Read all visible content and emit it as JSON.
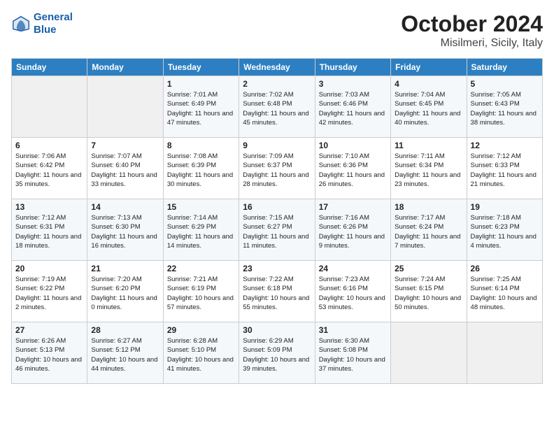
{
  "header": {
    "logo_line1": "General",
    "logo_line2": "Blue",
    "month": "October 2024",
    "location": "Misilmeri, Sicily, Italy"
  },
  "days_of_week": [
    "Sunday",
    "Monday",
    "Tuesday",
    "Wednesday",
    "Thursday",
    "Friday",
    "Saturday"
  ],
  "weeks": [
    [
      {
        "day": "",
        "content": ""
      },
      {
        "day": "",
        "content": ""
      },
      {
        "day": "1",
        "content": "Sunrise: 7:01 AM\nSunset: 6:49 PM\nDaylight: 11 hours and 47 minutes."
      },
      {
        "day": "2",
        "content": "Sunrise: 7:02 AM\nSunset: 6:48 PM\nDaylight: 11 hours and 45 minutes."
      },
      {
        "day": "3",
        "content": "Sunrise: 7:03 AM\nSunset: 6:46 PM\nDaylight: 11 hours and 42 minutes."
      },
      {
        "day": "4",
        "content": "Sunrise: 7:04 AM\nSunset: 6:45 PM\nDaylight: 11 hours and 40 minutes."
      },
      {
        "day": "5",
        "content": "Sunrise: 7:05 AM\nSunset: 6:43 PM\nDaylight: 11 hours and 38 minutes."
      }
    ],
    [
      {
        "day": "6",
        "content": "Sunrise: 7:06 AM\nSunset: 6:42 PM\nDaylight: 11 hours and 35 minutes."
      },
      {
        "day": "7",
        "content": "Sunrise: 7:07 AM\nSunset: 6:40 PM\nDaylight: 11 hours and 33 minutes."
      },
      {
        "day": "8",
        "content": "Sunrise: 7:08 AM\nSunset: 6:39 PM\nDaylight: 11 hours and 30 minutes."
      },
      {
        "day": "9",
        "content": "Sunrise: 7:09 AM\nSunset: 6:37 PM\nDaylight: 11 hours and 28 minutes."
      },
      {
        "day": "10",
        "content": "Sunrise: 7:10 AM\nSunset: 6:36 PM\nDaylight: 11 hours and 26 minutes."
      },
      {
        "day": "11",
        "content": "Sunrise: 7:11 AM\nSunset: 6:34 PM\nDaylight: 11 hours and 23 minutes."
      },
      {
        "day": "12",
        "content": "Sunrise: 7:12 AM\nSunset: 6:33 PM\nDaylight: 11 hours and 21 minutes."
      }
    ],
    [
      {
        "day": "13",
        "content": "Sunrise: 7:12 AM\nSunset: 6:31 PM\nDaylight: 11 hours and 18 minutes."
      },
      {
        "day": "14",
        "content": "Sunrise: 7:13 AM\nSunset: 6:30 PM\nDaylight: 11 hours and 16 minutes."
      },
      {
        "day": "15",
        "content": "Sunrise: 7:14 AM\nSunset: 6:29 PM\nDaylight: 11 hours and 14 minutes."
      },
      {
        "day": "16",
        "content": "Sunrise: 7:15 AM\nSunset: 6:27 PM\nDaylight: 11 hours and 11 minutes."
      },
      {
        "day": "17",
        "content": "Sunrise: 7:16 AM\nSunset: 6:26 PM\nDaylight: 11 hours and 9 minutes."
      },
      {
        "day": "18",
        "content": "Sunrise: 7:17 AM\nSunset: 6:24 PM\nDaylight: 11 hours and 7 minutes."
      },
      {
        "day": "19",
        "content": "Sunrise: 7:18 AM\nSunset: 6:23 PM\nDaylight: 11 hours and 4 minutes."
      }
    ],
    [
      {
        "day": "20",
        "content": "Sunrise: 7:19 AM\nSunset: 6:22 PM\nDaylight: 11 hours and 2 minutes."
      },
      {
        "day": "21",
        "content": "Sunrise: 7:20 AM\nSunset: 6:20 PM\nDaylight: 11 hours and 0 minutes."
      },
      {
        "day": "22",
        "content": "Sunrise: 7:21 AM\nSunset: 6:19 PM\nDaylight: 10 hours and 57 minutes."
      },
      {
        "day": "23",
        "content": "Sunrise: 7:22 AM\nSunset: 6:18 PM\nDaylight: 10 hours and 55 minutes."
      },
      {
        "day": "24",
        "content": "Sunrise: 7:23 AM\nSunset: 6:16 PM\nDaylight: 10 hours and 53 minutes."
      },
      {
        "day": "25",
        "content": "Sunrise: 7:24 AM\nSunset: 6:15 PM\nDaylight: 10 hours and 50 minutes."
      },
      {
        "day": "26",
        "content": "Sunrise: 7:25 AM\nSunset: 6:14 PM\nDaylight: 10 hours and 48 minutes."
      }
    ],
    [
      {
        "day": "27",
        "content": "Sunrise: 6:26 AM\nSunset: 5:13 PM\nDaylight: 10 hours and 46 minutes."
      },
      {
        "day": "28",
        "content": "Sunrise: 6:27 AM\nSunset: 5:12 PM\nDaylight: 10 hours and 44 minutes."
      },
      {
        "day": "29",
        "content": "Sunrise: 6:28 AM\nSunset: 5:10 PM\nDaylight: 10 hours and 41 minutes."
      },
      {
        "day": "30",
        "content": "Sunrise: 6:29 AM\nSunset: 5:09 PM\nDaylight: 10 hours and 39 minutes."
      },
      {
        "day": "31",
        "content": "Sunrise: 6:30 AM\nSunset: 5:08 PM\nDaylight: 10 hours and 37 minutes."
      },
      {
        "day": "",
        "content": ""
      },
      {
        "day": "",
        "content": ""
      }
    ]
  ]
}
